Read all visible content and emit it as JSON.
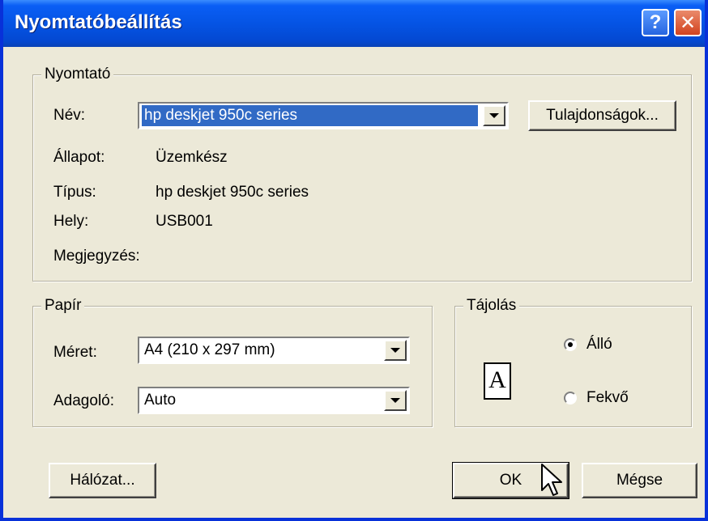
{
  "window": {
    "title": "Nyomtatóbeállítás"
  },
  "titlebar": {
    "help_glyph": "?",
    "close_glyph": "✕"
  },
  "printer": {
    "group_title": "Nyomtató",
    "name_label": "Név:",
    "name_value": "hp deskjet 950c series",
    "properties_button": "Tulajdonságok...",
    "status_label": "Állapot:",
    "status_value": "Üzemkész",
    "type_label": "Típus:",
    "type_value": "hp deskjet 950c series",
    "location_label": "Hely:",
    "location_value": "USB001",
    "comment_label": "Megjegyzés:"
  },
  "paper": {
    "group_title": "Papír",
    "size_label": "Méret:",
    "size_value": "A4 (210 x 297 mm)",
    "source_label": "Adagoló:",
    "source_value": "Auto"
  },
  "orientation": {
    "group_title": "Tájolás",
    "icon_letter": "A",
    "portrait_label": "Álló",
    "landscape_label": "Fekvő",
    "selected": "portrait"
  },
  "buttons": {
    "network": "Hálózat...",
    "ok": "OK",
    "cancel": "Mégse"
  }
}
